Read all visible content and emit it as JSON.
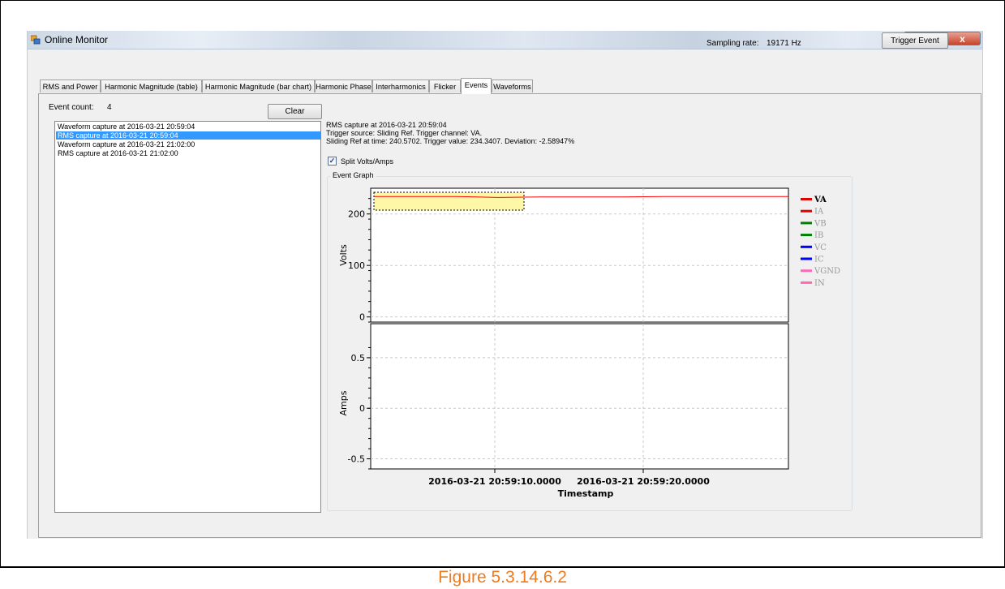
{
  "window": {
    "title": "Online Monitor",
    "sampling_label": "Sampling rate:",
    "sampling_value": "19171 Hz",
    "trigger_button": "Trigger Event",
    "controls": {
      "minimize": "—",
      "maximize": "□",
      "close": "x"
    }
  },
  "tabs": [
    {
      "label": "RMS and Power"
    },
    {
      "label": "Harmonic Magnitude (table)"
    },
    {
      "label": "Harmonic Magnitude (bar chart)"
    },
    {
      "label": "Harmonic Phase"
    },
    {
      "label": "Interharmonics"
    },
    {
      "label": "Flicker"
    },
    {
      "label": "Events",
      "active": true
    },
    {
      "label": "Waveforms"
    }
  ],
  "events": {
    "count_label": "Event count:",
    "count_value": "4",
    "clear_button": "Clear",
    "items": [
      "Waveform capture at 2016-03-21 20:59:04",
      "RMS capture at 2016-03-21 20:59:04",
      "Waveform capture at 2016-03-21 21:02:00",
      "RMS capture at 2016-03-21 21:02:00"
    ],
    "selected_index": 1
  },
  "details": {
    "line1": "RMS capture at 2016-03-21 20:59:04",
    "line2": "Trigger source: Sliding Ref. Trigger channel: VA.",
    "line3": "Sliding Ref at time: 240.5702. Trigger value: 234.3407. Deviation: -2.58947%",
    "split_label": "Split Volts/Amps",
    "split_checked": true,
    "graph_title": "Event Graph"
  },
  "chart_data": {
    "type": "line",
    "xlabel": "Timestamp",
    "x_ticks": [
      "2016-03-21 20:59:10.0000",
      "2016-03-21 20:59:20.0000"
    ],
    "volts_panel": {
      "ylabel": "Volts",
      "ylim": [
        -10,
        250
      ],
      "y_ticks": [
        0,
        100,
        200
      ],
      "series": [
        {
          "name": "VA",
          "color": "#ff0000",
          "values": [
            234,
            234,
            234,
            232,
            233,
            233,
            233,
            234,
            234,
            234,
            234
          ]
        }
      ]
    },
    "amps_panel": {
      "ylabel": "Amps",
      "ylim": [
        -0.6,
        0.7
      ],
      "y_ticks": [
        0.5,
        0,
        -0.5
      ]
    },
    "legend": [
      {
        "name": "VA",
        "color": "#e00000",
        "bold": true
      },
      {
        "name": "IA",
        "color": "#e00000"
      },
      {
        "name": "VB",
        "color": "#008000"
      },
      {
        "name": "IB",
        "color": "#008000"
      },
      {
        "name": "VC",
        "color": "#0000ff"
      },
      {
        "name": "IC",
        "color": "#0000ff"
      },
      {
        "name": "VGND",
        "color": "#ff69b4"
      },
      {
        "name": "IN",
        "color": "#ff69b4"
      }
    ],
    "grid": true,
    "legend_position": "right"
  },
  "caption": "Figure 5.3.14.6.2"
}
